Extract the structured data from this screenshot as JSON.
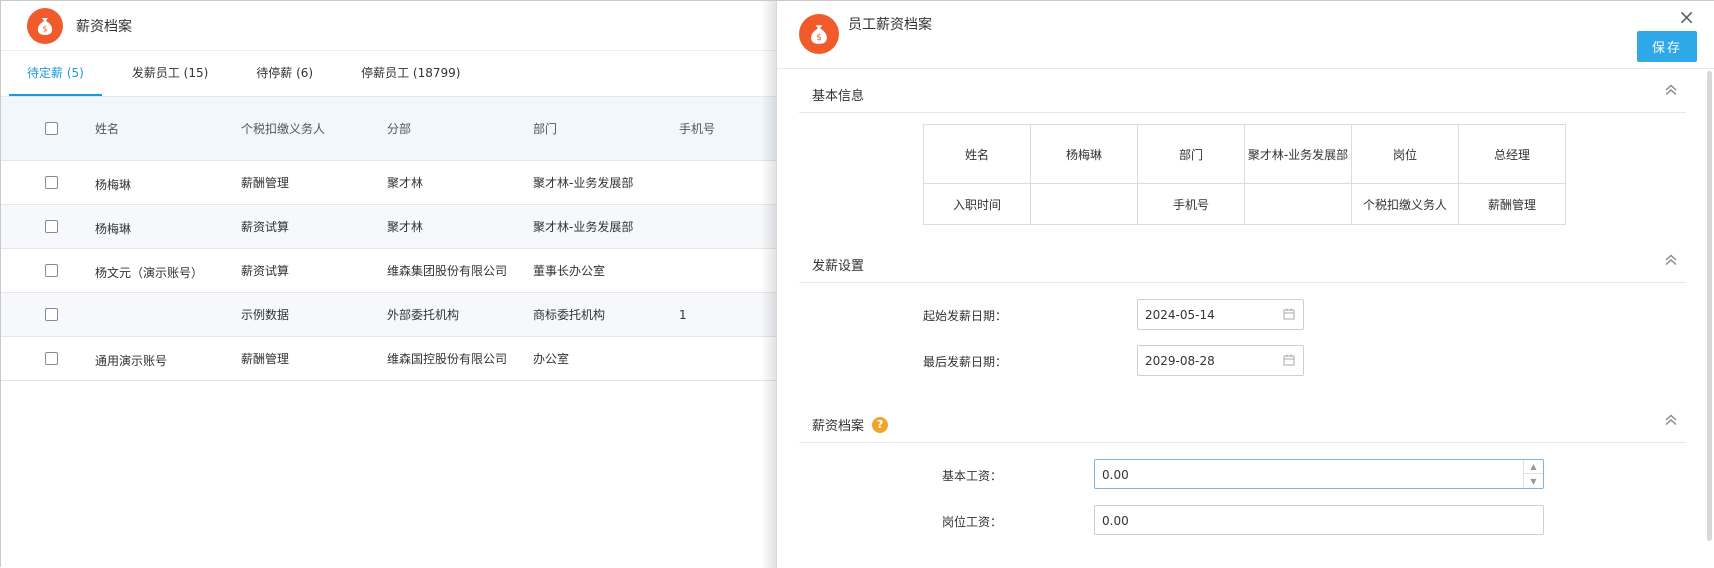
{
  "left": {
    "title": "薪资档案",
    "tabs": [
      {
        "label": "待定薪 (5)",
        "active": true
      },
      {
        "label": "发薪员工 (15)",
        "active": false
      },
      {
        "label": "待停薪 (6)",
        "active": false
      },
      {
        "label": "停薪员工 (18799)",
        "active": false
      }
    ],
    "columns": [
      "姓名",
      "个税扣缴义务人",
      "分部",
      "部门",
      "手机号"
    ],
    "rows": [
      {
        "name": "杨梅琳",
        "tax_agent": "薪酬管理",
        "branch": "聚才林",
        "dept": "聚才林-业务发展部",
        "phone": ""
      },
      {
        "name": "杨梅琳",
        "tax_agent": "薪资试算",
        "branch": "聚才林",
        "dept": "聚才林-业务发展部",
        "phone": ""
      },
      {
        "name": "杨文元（演示账号）",
        "tax_agent": "薪资试算",
        "branch": "维森集团股份有限公司",
        "dept": "董事长办公室",
        "phone": ""
      },
      {
        "name": "",
        "tax_agent": "示例数据",
        "branch": "外部委托机构",
        "dept": "商标委托机构",
        "phone": "1"
      },
      {
        "name": "通用演示账号",
        "tax_agent": "薪酬管理",
        "branch": "维森国控股份有限公司",
        "dept": "办公室",
        "phone": ""
      }
    ]
  },
  "drawer": {
    "title": "员工薪资档案",
    "save_label": "保存",
    "close_glyph": "×",
    "sections": {
      "basic": "基本信息",
      "payroll": "发薪设置",
      "archive": "薪资档案"
    },
    "info_table": {
      "name_label": "姓名",
      "name_value": "杨梅琳",
      "dept_label": "部门",
      "dept_value": "聚才林-业务发展部",
      "post_label": "岗位",
      "post_value": "总经理",
      "join_label": "入职时间",
      "join_value": "",
      "phone_label": "手机号",
      "phone_value": "",
      "tax_label": "个税扣缴义务人",
      "tax_value": "薪酬管理"
    },
    "payroll": {
      "start_label": "起始发薪日期：",
      "start_value": "2024-05-14",
      "end_label": "最后发薪日期：",
      "end_value": "2029-08-28"
    },
    "archive": {
      "help_glyph": "?",
      "base_label": "基本工资：",
      "base_value": "0.00",
      "post_label": "岗位工资：",
      "post_value": "0.00"
    }
  },
  "colors": {
    "accent": "#1a9ad6",
    "logo": "#f15a2a",
    "save": "#2ea8e6",
    "help": "#f0a52b"
  }
}
